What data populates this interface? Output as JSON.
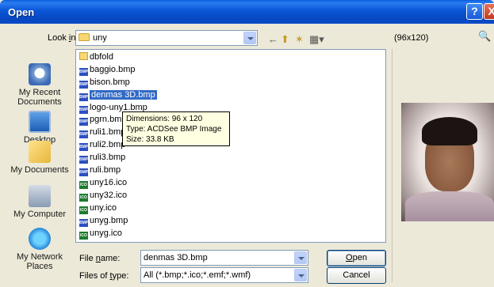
{
  "window": {
    "title": "Open",
    "help_glyph": "?",
    "close_glyph": "X"
  },
  "lookin": {
    "label": "Look in:",
    "label_prefix": "Look ",
    "label_underlined": "i",
    "label_suffix": "n:",
    "value": "uny"
  },
  "toolbar": {
    "back_glyph": "←",
    "up_glyph": "⬆",
    "newfolder_glyph": "✶",
    "views_glyph": "▦▾"
  },
  "preview": {
    "size_label": "(96x120)",
    "button_glyph": "🔍"
  },
  "places": [
    {
      "label": "My Recent Documents",
      "icon": "recent-documents-icon"
    },
    {
      "label": "Desktop",
      "icon": "desktop-icon"
    },
    {
      "label": "My Documents",
      "icon": "my-documents-icon"
    },
    {
      "label": "My Computer",
      "icon": "my-computer-icon"
    },
    {
      "label": "My Network Places",
      "icon": "network-places-icon"
    }
  ],
  "files": [
    {
      "name": "dbfold",
      "type": "folder",
      "badge": ""
    },
    {
      "name": "baggio.bmp",
      "type": "bmp",
      "badge": "BMP"
    },
    {
      "name": "bison.bmp",
      "type": "bmp",
      "badge": "BMP"
    },
    {
      "name": "denmas 3D.bmp",
      "type": "bmp",
      "badge": "BMP"
    },
    {
      "name": "logo-uny1.bmp",
      "type": "bmp",
      "badge": "BMP"
    },
    {
      "name": "pgrn.bmp",
      "type": "bmp",
      "badge": "BMP"
    },
    {
      "name": "ruli1.bmp",
      "type": "bmp",
      "badge": "BMP"
    },
    {
      "name": "ruli2.bmp",
      "type": "bmp",
      "badge": "BMP"
    },
    {
      "name": "ruli3.bmp",
      "type": "bmp",
      "badge": "BMP"
    },
    {
      "name": "ruli.bmp",
      "type": "bmp",
      "badge": "BMP"
    },
    {
      "name": "uny16.ico",
      "type": "ico",
      "badge": "ICO"
    },
    {
      "name": "uny32.ico",
      "type": "ico",
      "badge": "ICO"
    },
    {
      "name": "uny.ico",
      "type": "ico",
      "badge": "ICO"
    },
    {
      "name": "unyg.bmp",
      "type": "bmp",
      "badge": "BMP"
    },
    {
      "name": "unyg.ico",
      "type": "ico",
      "badge": "ICO"
    }
  ],
  "selected_file": "denmas 3D.bmp",
  "tooltip": {
    "dimensions": "Dimensions: 96 x 120",
    "type": "Type: ACDSee BMP Image",
    "size": "Size: 33.8 KB"
  },
  "filename": {
    "label_prefix": "File ",
    "label_underlined": "n",
    "label_suffix": "ame:",
    "value": "denmas 3D.bmp"
  },
  "filetype": {
    "label_prefix": "Files of ",
    "label_underlined": "t",
    "label_suffix": "ype:",
    "value": "All (*.bmp;*.ico;*.emf;*.wmf)"
  },
  "buttons": {
    "open_underlined": "O",
    "open_rest": "pen",
    "cancel": "Cancel"
  },
  "colors": {
    "titlebar": "#0a55d6",
    "selection": "#316ac5",
    "tooltip_bg": "#ffffe1"
  }
}
